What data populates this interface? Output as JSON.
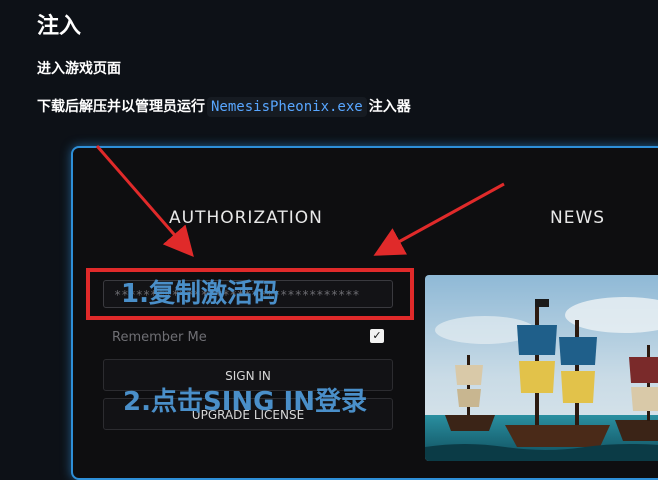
{
  "doc": {
    "title": "注入",
    "line1": "进入游戏页面",
    "line2_prefix": "下载后解压并以管理员运行",
    "line2_code": "NemesisPheonix.exe",
    "line2_suffix": "注入器"
  },
  "app": {
    "authorization_title": "AUTHORIZATION",
    "news_title": "NEWS",
    "key_field_value": "**********************************",
    "remember_me_label": "Remember Me",
    "remember_me_checked": true,
    "sign_in_label": "SIGN IN",
    "upgrade_license_label": "UPGRADE LICENSE"
  },
  "annotations": {
    "step1": "1.复制激活码",
    "step2": "2.点击SING IN登录"
  },
  "colors": {
    "page_bg": "#0d1117",
    "frame_border": "#2e8fd8",
    "annotation_red": "#e02a2a",
    "annotation_blue": "#4a8fc9",
    "code_text": "#58a6ff"
  }
}
